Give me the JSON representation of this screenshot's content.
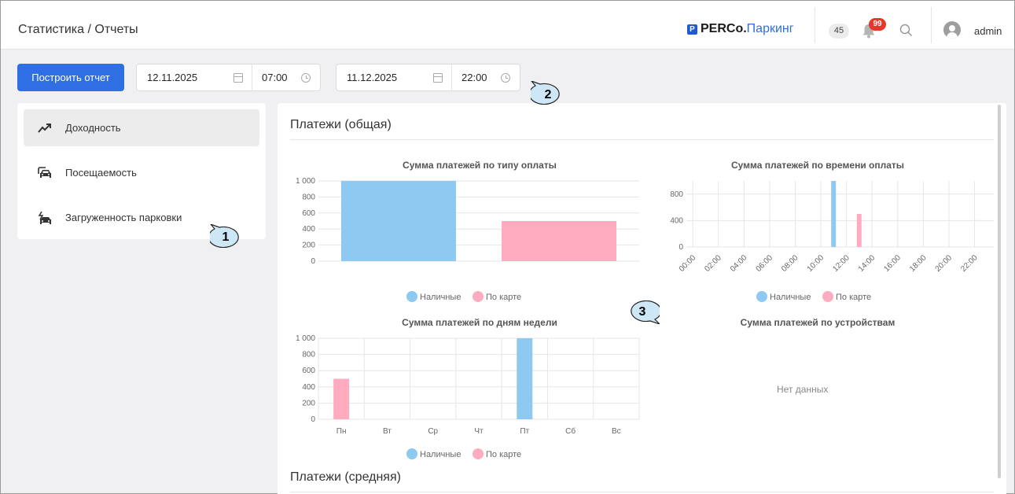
{
  "header": {
    "breadcrumb": "Статистика / Отчеты",
    "logo_mark": "P",
    "logo_brand": "PERCo.",
    "logo_product": "Паркинг",
    "counter": "45",
    "notifications": "99",
    "user": "admin"
  },
  "toolbar": {
    "build_label": "Построить отчет",
    "from_date": "12.11.2025",
    "from_time": "07:00",
    "to_date": "11.12.2025",
    "to_time": "22:00"
  },
  "sidebar": {
    "items": [
      {
        "label": "Доходность",
        "icon": "trend-up-icon",
        "active": true
      },
      {
        "label": "Посещаемость",
        "icon": "cars-icon",
        "active": false
      },
      {
        "label": "Загруженность парковки",
        "icon": "car-lightning-icon",
        "active": false
      }
    ]
  },
  "callouts": [
    "1",
    "2",
    "3"
  ],
  "sections": {
    "total": "Платежи (общая)",
    "average": "Платежи (средняя)"
  },
  "colors": {
    "cash": "#8ec9f2",
    "card": "#ffabc0",
    "accent": "#2f6fe3"
  },
  "legend": {
    "cash": "Наличные",
    "card": "По карте"
  },
  "no_data": "Нет данных",
  "chart_data": [
    {
      "type": "bar",
      "title": "Сумма платежей по типу оплаты",
      "categories": [
        "Наличные",
        "По карте"
      ],
      "values": [
        1000,
        500
      ],
      "yticks": [
        "1 000",
        "800",
        "600",
        "400",
        "200",
        "0"
      ],
      "ylim": [
        0,
        1000
      ]
    },
    {
      "type": "bar",
      "title": "Сумма платежей по времени оплаты",
      "categories": [
        "00:00",
        "01:00",
        "02:00",
        "03:00",
        "04:00",
        "05:00",
        "06:00",
        "07:00",
        "08:00",
        "09:00",
        "10:00",
        "11:00",
        "12:00",
        "13:00",
        "14:00",
        "15:00",
        "16:00",
        "17:00",
        "18:00",
        "19:00",
        "20:00",
        "21:00",
        "22:00",
        "23:00"
      ],
      "xticks": [
        "00:00",
        "02:00",
        "04:00",
        "06:00",
        "08:00",
        "10:00",
        "12:00",
        "14:00",
        "16:00",
        "18:00",
        "20:00",
        "22:00"
      ],
      "yticks": [
        "800",
        "400",
        "0"
      ],
      "ylim": [
        0,
        1000
      ],
      "series": [
        {
          "name": "Наличные",
          "values": [
            0,
            0,
            0,
            0,
            0,
            0,
            0,
            0,
            0,
            0,
            0,
            1000,
            0,
            0,
            0,
            0,
            0,
            0,
            0,
            0,
            0,
            0,
            0,
            0
          ]
        },
        {
          "name": "По карте",
          "values": [
            0,
            0,
            0,
            0,
            0,
            0,
            0,
            0,
            0,
            0,
            0,
            0,
            0,
            500,
            0,
            0,
            0,
            0,
            0,
            0,
            0,
            0,
            0,
            0
          ]
        }
      ]
    },
    {
      "type": "bar",
      "title": "Сумма платежей по дням недели",
      "categories": [
        "Пн",
        "Вт",
        "Ср",
        "Чт",
        "Пт",
        "Сб",
        "Вс"
      ],
      "yticks": [
        "1 000",
        "800",
        "600",
        "400",
        "200",
        "0"
      ],
      "ylim": [
        0,
        1000
      ],
      "series": [
        {
          "name": "Наличные",
          "values": [
            0,
            0,
            0,
            0,
            1000,
            0,
            0
          ]
        },
        {
          "name": "По карте",
          "values": [
            500,
            0,
            0,
            0,
            0,
            0,
            0
          ]
        }
      ]
    },
    {
      "type": "bar",
      "title": "Сумма платежей по устройствам",
      "categories": [],
      "values": []
    }
  ]
}
